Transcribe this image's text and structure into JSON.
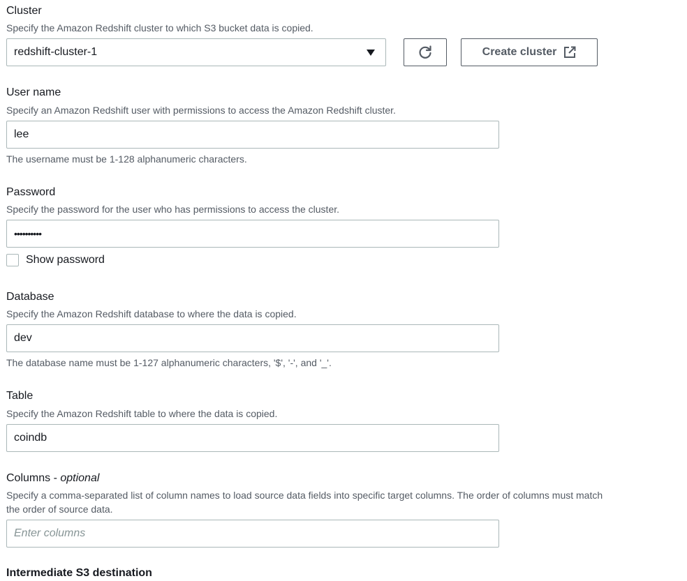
{
  "cluster": {
    "label": "Cluster",
    "description": "Specify the Amazon Redshift cluster to which S3 bucket data is copied.",
    "selected": "redshift-cluster-1",
    "create_label": "Create cluster"
  },
  "username": {
    "label": "User name",
    "description": "Specify an Amazon Redshift user with permissions to access the Amazon Redshift cluster.",
    "value": "lee",
    "hint": "The username must be 1-128 alphanumeric characters."
  },
  "password": {
    "label": "Password",
    "description": "Specify the password for the user who has permissions to access the cluster.",
    "masked_value": "••••••••••",
    "show_label": "Show password"
  },
  "database": {
    "label": "Database",
    "description": "Specify the Amazon Redshift database to where the data is copied.",
    "value": "dev",
    "hint": "The database name must be 1-127 alphanumeric characters, '$', '-', and '_'."
  },
  "table": {
    "label": "Table",
    "description": "Specify the Amazon Redshift table to where the data is copied.",
    "value": "coindb"
  },
  "columns": {
    "label": "Columns - ",
    "optional": "optional",
    "description_line1": "Specify a comma-separated list of column names to load source data fields into specific target columns. The order of columns must match",
    "description_line2": "the order of source data.",
    "placeholder": "Enter columns"
  },
  "intermediate": {
    "title": "Intermediate S3 destination"
  }
}
